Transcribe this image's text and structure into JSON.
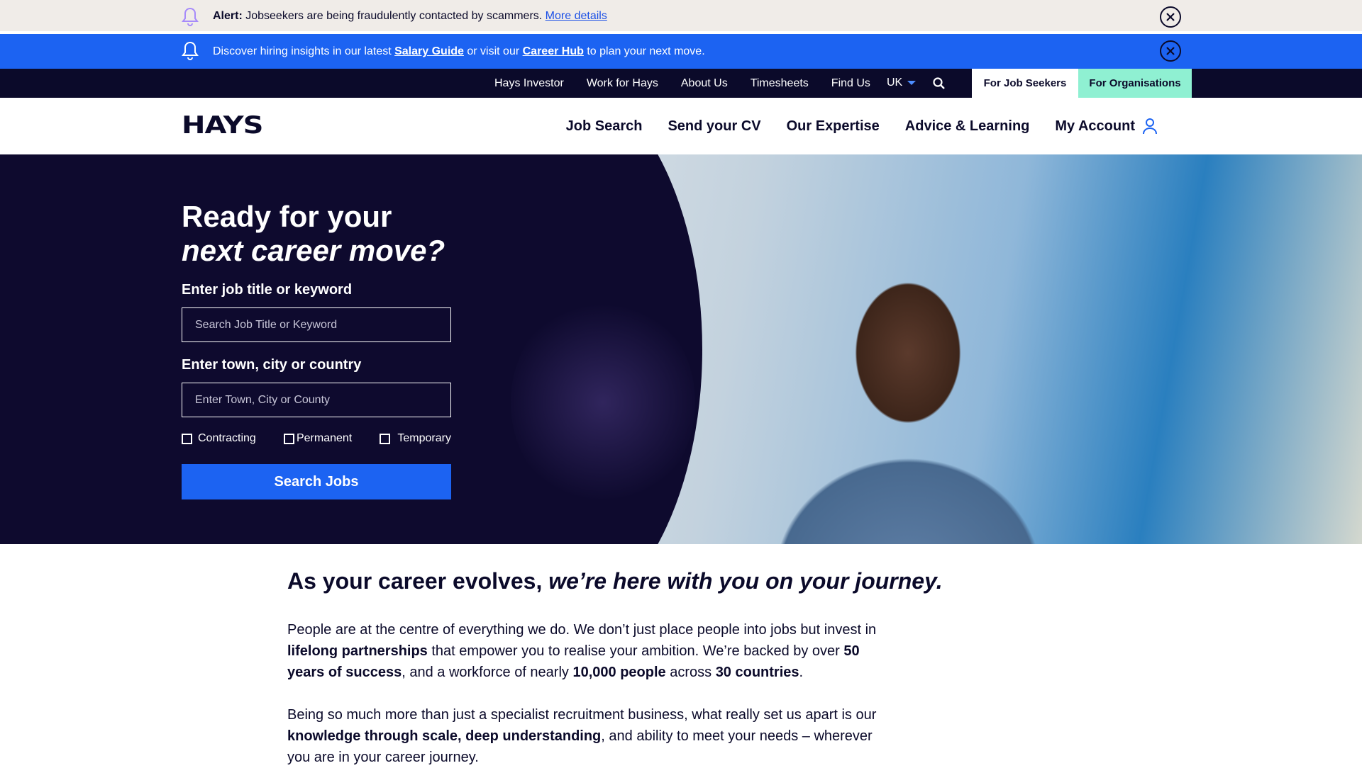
{
  "alert": {
    "label": "Alert:",
    "text": " Jobseekers are being fraudulently contacted by scammers. ",
    "link": "More details"
  },
  "info": {
    "pre": "Discover hiring insights in our latest ",
    "link1": "Salary Guide",
    "mid": " or visit our ",
    "link2": "Career Hub",
    "post": " to plan your next move."
  },
  "utility_nav": {
    "items": [
      "Hays Investor",
      "Work for Hays",
      "About Us",
      "Timesheets",
      "Find Us"
    ],
    "region": "UK",
    "tab_seekers": "For Job Seekers",
    "tab_orgs": "For Organisations"
  },
  "header": {
    "logo": "HAYS",
    "nav": [
      "Job Search",
      "Send your CV",
      "Our Expertise",
      "Advice & Learning",
      "My Account"
    ]
  },
  "hero": {
    "title_line1": "Ready for your",
    "title_line2": "next career move?",
    "keyword_label": "Enter job title or keyword",
    "keyword_placeholder": "Search Job Title or Keyword",
    "location_label": "Enter town, city or country",
    "location_placeholder": "Enter Town, City or County",
    "job_types": [
      "Contracting",
      "Permanent",
      "Temporary"
    ],
    "search_button": "Search Jobs"
  },
  "content": {
    "headline_bold": "As your career evolves,",
    "headline_italic": " we’re here with you on your journey.",
    "p1": [
      {
        "t": "People are at the centre of everything we do. We don’t just place people into jobs but invest in ",
        "b": false
      },
      {
        "t": "lifelong partnerships",
        "b": true
      },
      {
        "t": " that empower you to realise your ambition. We’re backed by over ",
        "b": false
      },
      {
        "t": "50 years of success",
        "b": true
      },
      {
        "t": ", and a workforce of nearly ",
        "b": false
      },
      {
        "t": "10,000 people",
        "b": true
      },
      {
        "t": " across ",
        "b": false
      },
      {
        "t": "30 countries",
        "b": true
      },
      {
        "t": ".",
        "b": false
      }
    ],
    "p2": [
      {
        "t": "Being so much more than just a specialist recruitment business, what really set us apart is our ",
        "b": false
      },
      {
        "t": "knowledge through scale, deep understanding",
        "b": true
      },
      {
        "t": ", and ability to meet your needs – wherever you are in your career journey.",
        "b": false
      }
    ]
  },
  "colors": {
    "navy": "#0b0a2a",
    "blue": "#1c63f2",
    "mint": "#8ff0d2",
    "alert_bg": "#f0ece8"
  }
}
